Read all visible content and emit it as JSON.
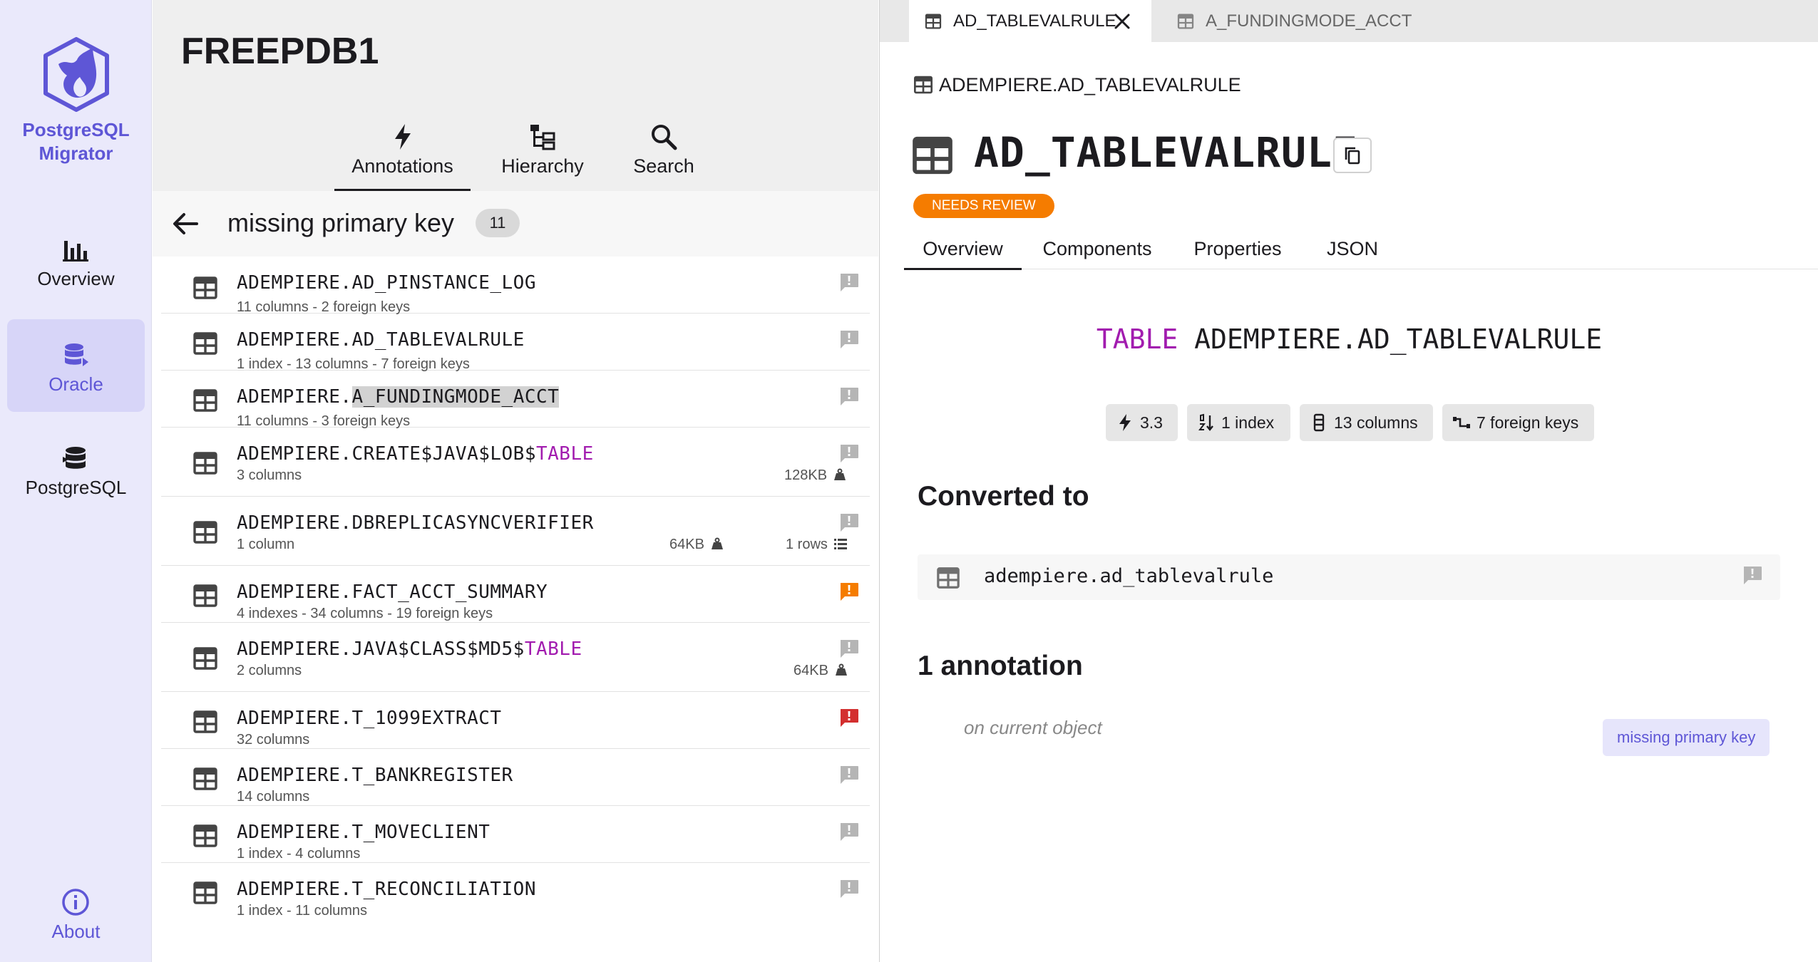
{
  "app": {
    "name": "PostgreSQL Migrator"
  },
  "rail": {
    "items": [
      {
        "label": "Overview"
      },
      {
        "label": "Oracle"
      },
      {
        "label": "PostgreSQL"
      }
    ],
    "about": "About"
  },
  "middle": {
    "db_title": "FREEPDB1",
    "tabs": [
      {
        "label": "Annotations"
      },
      {
        "label": "Hierarchy"
      },
      {
        "label": "Search"
      }
    ],
    "filter": {
      "title": "missing primary key",
      "count": "11"
    },
    "rows": [
      {
        "name": "ADEMPIERE.AD_PINSTANCE_LOG",
        "sub": "11 columns - 2 foreign keys"
      },
      {
        "name": "ADEMPIERE.AD_TABLEVALRULE",
        "sub": "1 index - 13 columns - 7 foreign keys"
      },
      {
        "name_prefix": "ADEMPIERE.",
        "name_highlight": "A_FUNDINGMODE_ACCT",
        "sub": "11 columns - 3 foreign keys"
      },
      {
        "name_prefix": "ADEMPIERE.CREATE$JAVA$LOB$",
        "name_keyword": "TABLE",
        "sub": "3 columns",
        "size": "128KB"
      },
      {
        "name": "ADEMPIERE.DBREPLICASYNCVERIFIER",
        "sub": "1 column",
        "size": "64KB",
        "rows": "1 rows"
      },
      {
        "name": "ADEMPIERE.FACT_ACCT_SUMMARY",
        "sub": "4 indexes - 34 columns - 19 foreign keys"
      },
      {
        "name_prefix": "ADEMPIERE.JAVA$CLASS$MD5$",
        "name_keyword": "TABLE",
        "sub": "2 columns",
        "size": "64KB"
      },
      {
        "name": "ADEMPIERE.T_1099EXTRACT",
        "sub": "32 columns"
      },
      {
        "name": "ADEMPIERE.T_BANKREGISTER",
        "sub": "14 columns"
      },
      {
        "name": "ADEMPIERE.T_MOVECLIENT",
        "sub": "1 index - 4 columns"
      },
      {
        "name": "ADEMPIERE.T_RECONCILIATION",
        "sub": "1 index - 11 columns"
      }
    ]
  },
  "right": {
    "tabs": [
      {
        "label": "AD_TABLEVALRULE"
      },
      {
        "label": "A_FUNDINGMODE_ACCT"
      }
    ],
    "breadcrumb": "ADEMPIERE.AD_TABLEVALRULE",
    "title": "AD_TABLEVALRULE",
    "badge": "NEEDS REVIEW",
    "detail_tabs": [
      {
        "label": "Overview"
      },
      {
        "label": "Components"
      },
      {
        "label": "Properties"
      },
      {
        "label": "JSON"
      }
    ],
    "ddl": {
      "keyword": "TABLE",
      "name": "ADEMPIERE.AD_TABLEVALRULE"
    },
    "chips": [
      {
        "label": "3.3"
      },
      {
        "label": "1 index"
      },
      {
        "label": "13 columns"
      },
      {
        "label": "7 foreign keys"
      }
    ],
    "converted_heading": "Converted to",
    "converted_name": "adempiere.ad_tablevalrule",
    "annotation_heading": "1 annotation",
    "annotation_scope": "on current object",
    "annotation_tag": "missing primary key"
  },
  "colors": {
    "accent": "#5e56d6",
    "keyword": "#a21caf",
    "warning": "#f57c00",
    "error": "#d32f2f",
    "flag_default": "#b5b5b5"
  }
}
